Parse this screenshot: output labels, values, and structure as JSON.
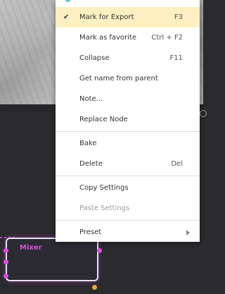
{
  "canvas": {
    "node": {
      "label": "Mixer",
      "accent": "#d94fe0",
      "border": "#e7e3f5",
      "output_port_color": "#f2a43a"
    }
  },
  "context_menu": {
    "items": [
      {
        "label": "Mark for Export",
        "shortcut": "F3",
        "checked": true,
        "highlighted": true,
        "icon": "check-icon"
      },
      {
        "label": "Mark as favorite",
        "shortcut": "Ctrl + F2"
      },
      {
        "label": "Collapse",
        "shortcut": "F11"
      },
      {
        "label": "Get name from parent",
        "shortcut": ""
      },
      {
        "label": "Note...",
        "shortcut": ""
      },
      {
        "label": "Replace Node",
        "shortcut": ""
      },
      {
        "label": "Bake",
        "shortcut": ""
      },
      {
        "label": "Delete",
        "shortcut": "Del"
      },
      {
        "label": "Copy Settings",
        "shortcut": ""
      },
      {
        "label": "Paste Settings",
        "shortcut": "",
        "disabled": true
      },
      {
        "label": "Preset",
        "shortcut": "",
        "submenu": true,
        "icon": "chevron-right-icon"
      }
    ],
    "check_glyph": "✔",
    "highlight_color": "#fdf0c1"
  }
}
